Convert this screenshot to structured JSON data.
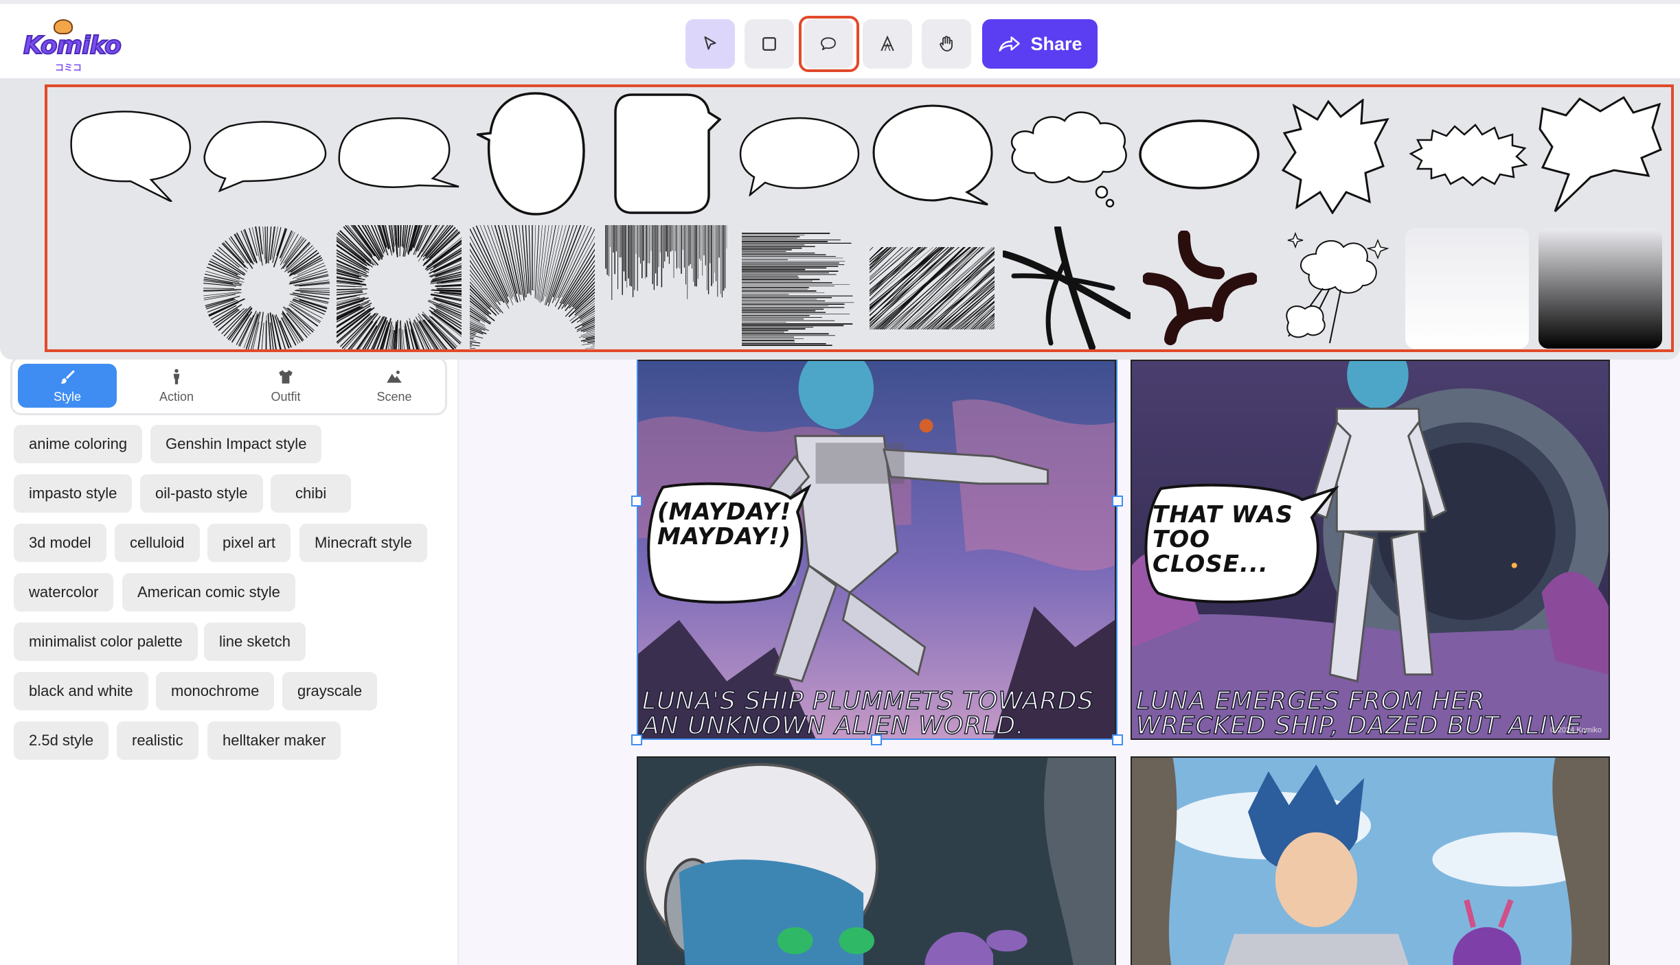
{
  "app": {
    "logo_text": "Komiko",
    "logo_sub": "コミコ"
  },
  "toolbar": {
    "tools": [
      {
        "name": "select-tool",
        "icon": "pointer-icon",
        "active": true
      },
      {
        "name": "rectangle-tool",
        "icon": "square-icon",
        "active": false
      },
      {
        "name": "speech-bubble-tool",
        "icon": "speech-bubble-icon",
        "active": false,
        "highlighted": true
      },
      {
        "name": "text-tool",
        "icon": "text-a-icon",
        "active": false
      },
      {
        "name": "pan-tool",
        "icon": "hand-icon",
        "active": false
      }
    ],
    "share_label": "Share",
    "accent_color": "#5b3df2"
  },
  "tabs": [
    {
      "label": "Style",
      "icon": "brush-icon",
      "active": true
    },
    {
      "label": "Action",
      "icon": "person-icon",
      "active": false
    },
    {
      "label": "Outfit",
      "icon": "shirt-icon",
      "active": false
    },
    {
      "label": "Scene",
      "icon": "landscape-icon",
      "active": false
    }
  ],
  "style_chips": [
    "anime coloring",
    "Genshin Impact style",
    "impasto style",
    "oil-pasto style",
    "chibi",
    "3d model",
    "celluloid",
    "pixel art",
    "Minecraft style",
    "watercolor",
    "American comic style",
    "minimalist color palette",
    "line sketch",
    "black and white",
    "monochrome",
    "grayscale",
    "2.5d style",
    "realistic",
    "helltaker maker"
  ],
  "bubble_shapes_row1": [
    "speech-bubble-round",
    "speech-bubble-wide",
    "speech-bubble-tail-right",
    "speech-bubble-tall-oval",
    "speech-bubble-rounded-rect",
    "speech-bubble-oval",
    "speech-bubble-large-round",
    "thought-bubble-cloud",
    "ellipse-plain",
    "burst-star",
    "burst-wide",
    "shout-bubble"
  ],
  "bubble_shapes_row2": [
    "radial-lines-sparse",
    "radial-lines-dense",
    "focus-lines-top",
    "speed-lines-vertical",
    "speed-lines-horizontal",
    "speed-lines-diagonal",
    "cross-strike",
    "anger-mark",
    "explosion-puff",
    "gradient-white",
    "gradient-black"
  ],
  "comic": {
    "panels": [
      {
        "speech": "(MAYDAY! MAYDAY!)",
        "caption": "LUNA'S SHIP PLUMMETS TOWARDS AN UNKNOWN ALIEN WORLD."
      },
      {
        "speech": "THAT WAS TOO CLOSE...",
        "caption": "LUNA EMERGES FROM HER WRECKED SHIP, DAZED BUT ALIVE.",
        "watermark": "© 2024 Komiko"
      },
      {
        "speech": "",
        "caption": ""
      },
      {
        "speech": "",
        "caption": ""
      }
    ]
  }
}
